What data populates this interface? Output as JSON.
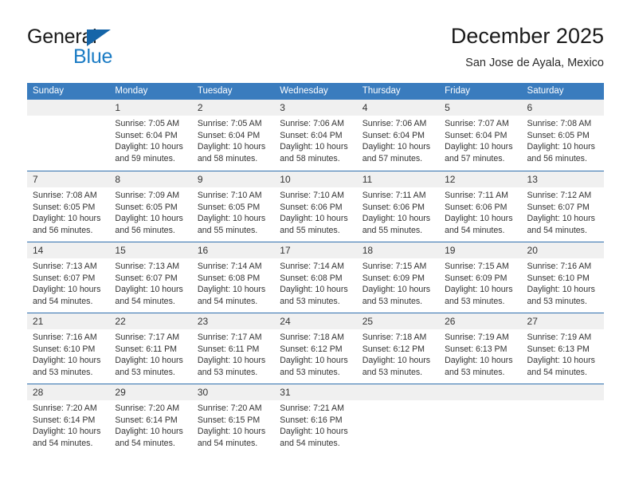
{
  "brand": {
    "name_top": "General",
    "name_bottom": "Blue",
    "triangle_color": "#1565a8",
    "blue_color": "#1a7bc4"
  },
  "header": {
    "title": "December 2025",
    "subtitle": "San Jose de Ayala, Mexico"
  },
  "theme": {
    "header_bg": "#3a7cbe",
    "row_divider": "#2f6fae",
    "day_band_bg": "#f0f0f0"
  },
  "weekdays": [
    "Sunday",
    "Monday",
    "Tuesday",
    "Wednesday",
    "Thursday",
    "Friday",
    "Saturday"
  ],
  "weeks": [
    [
      {
        "day": "",
        "lines": []
      },
      {
        "day": "1",
        "lines": [
          "Sunrise: 7:05 AM",
          "Sunset: 6:04 PM",
          "Daylight: 10 hours",
          "and 59 minutes."
        ]
      },
      {
        "day": "2",
        "lines": [
          "Sunrise: 7:05 AM",
          "Sunset: 6:04 PM",
          "Daylight: 10 hours",
          "and 58 minutes."
        ]
      },
      {
        "day": "3",
        "lines": [
          "Sunrise: 7:06 AM",
          "Sunset: 6:04 PM",
          "Daylight: 10 hours",
          "and 58 minutes."
        ]
      },
      {
        "day": "4",
        "lines": [
          "Sunrise: 7:06 AM",
          "Sunset: 6:04 PM",
          "Daylight: 10 hours",
          "and 57 minutes."
        ]
      },
      {
        "day": "5",
        "lines": [
          "Sunrise: 7:07 AM",
          "Sunset: 6:04 PM",
          "Daylight: 10 hours",
          "and 57 minutes."
        ]
      },
      {
        "day": "6",
        "lines": [
          "Sunrise: 7:08 AM",
          "Sunset: 6:05 PM",
          "Daylight: 10 hours",
          "and 56 minutes."
        ]
      }
    ],
    [
      {
        "day": "7",
        "lines": [
          "Sunrise: 7:08 AM",
          "Sunset: 6:05 PM",
          "Daylight: 10 hours",
          "and 56 minutes."
        ]
      },
      {
        "day": "8",
        "lines": [
          "Sunrise: 7:09 AM",
          "Sunset: 6:05 PM",
          "Daylight: 10 hours",
          "and 56 minutes."
        ]
      },
      {
        "day": "9",
        "lines": [
          "Sunrise: 7:10 AM",
          "Sunset: 6:05 PM",
          "Daylight: 10 hours",
          "and 55 minutes."
        ]
      },
      {
        "day": "10",
        "lines": [
          "Sunrise: 7:10 AM",
          "Sunset: 6:06 PM",
          "Daylight: 10 hours",
          "and 55 minutes."
        ]
      },
      {
        "day": "11",
        "lines": [
          "Sunrise: 7:11 AM",
          "Sunset: 6:06 PM",
          "Daylight: 10 hours",
          "and 55 minutes."
        ]
      },
      {
        "day": "12",
        "lines": [
          "Sunrise: 7:11 AM",
          "Sunset: 6:06 PM",
          "Daylight: 10 hours",
          "and 54 minutes."
        ]
      },
      {
        "day": "13",
        "lines": [
          "Sunrise: 7:12 AM",
          "Sunset: 6:07 PM",
          "Daylight: 10 hours",
          "and 54 minutes."
        ]
      }
    ],
    [
      {
        "day": "14",
        "lines": [
          "Sunrise: 7:13 AM",
          "Sunset: 6:07 PM",
          "Daylight: 10 hours",
          "and 54 minutes."
        ]
      },
      {
        "day": "15",
        "lines": [
          "Sunrise: 7:13 AM",
          "Sunset: 6:07 PM",
          "Daylight: 10 hours",
          "and 54 minutes."
        ]
      },
      {
        "day": "16",
        "lines": [
          "Sunrise: 7:14 AM",
          "Sunset: 6:08 PM",
          "Daylight: 10 hours",
          "and 54 minutes."
        ]
      },
      {
        "day": "17",
        "lines": [
          "Sunrise: 7:14 AM",
          "Sunset: 6:08 PM",
          "Daylight: 10 hours",
          "and 53 minutes."
        ]
      },
      {
        "day": "18",
        "lines": [
          "Sunrise: 7:15 AM",
          "Sunset: 6:09 PM",
          "Daylight: 10 hours",
          "and 53 minutes."
        ]
      },
      {
        "day": "19",
        "lines": [
          "Sunrise: 7:15 AM",
          "Sunset: 6:09 PM",
          "Daylight: 10 hours",
          "and 53 minutes."
        ]
      },
      {
        "day": "20",
        "lines": [
          "Sunrise: 7:16 AM",
          "Sunset: 6:10 PM",
          "Daylight: 10 hours",
          "and 53 minutes."
        ]
      }
    ],
    [
      {
        "day": "21",
        "lines": [
          "Sunrise: 7:16 AM",
          "Sunset: 6:10 PM",
          "Daylight: 10 hours",
          "and 53 minutes."
        ]
      },
      {
        "day": "22",
        "lines": [
          "Sunrise: 7:17 AM",
          "Sunset: 6:11 PM",
          "Daylight: 10 hours",
          "and 53 minutes."
        ]
      },
      {
        "day": "23",
        "lines": [
          "Sunrise: 7:17 AM",
          "Sunset: 6:11 PM",
          "Daylight: 10 hours",
          "and 53 minutes."
        ]
      },
      {
        "day": "24",
        "lines": [
          "Sunrise: 7:18 AM",
          "Sunset: 6:12 PM",
          "Daylight: 10 hours",
          "and 53 minutes."
        ]
      },
      {
        "day": "25",
        "lines": [
          "Sunrise: 7:18 AM",
          "Sunset: 6:12 PM",
          "Daylight: 10 hours",
          "and 53 minutes."
        ]
      },
      {
        "day": "26",
        "lines": [
          "Sunrise: 7:19 AM",
          "Sunset: 6:13 PM",
          "Daylight: 10 hours",
          "and 53 minutes."
        ]
      },
      {
        "day": "27",
        "lines": [
          "Sunrise: 7:19 AM",
          "Sunset: 6:13 PM",
          "Daylight: 10 hours",
          "and 54 minutes."
        ]
      }
    ],
    [
      {
        "day": "28",
        "lines": [
          "Sunrise: 7:20 AM",
          "Sunset: 6:14 PM",
          "Daylight: 10 hours",
          "and 54 minutes."
        ]
      },
      {
        "day": "29",
        "lines": [
          "Sunrise: 7:20 AM",
          "Sunset: 6:14 PM",
          "Daylight: 10 hours",
          "and 54 minutes."
        ]
      },
      {
        "day": "30",
        "lines": [
          "Sunrise: 7:20 AM",
          "Sunset: 6:15 PM",
          "Daylight: 10 hours",
          "and 54 minutes."
        ]
      },
      {
        "day": "31",
        "lines": [
          "Sunrise: 7:21 AM",
          "Sunset: 6:16 PM",
          "Daylight: 10 hours",
          "and 54 minutes."
        ]
      },
      {
        "day": "",
        "lines": []
      },
      {
        "day": "",
        "lines": []
      },
      {
        "day": "",
        "lines": []
      }
    ]
  ]
}
